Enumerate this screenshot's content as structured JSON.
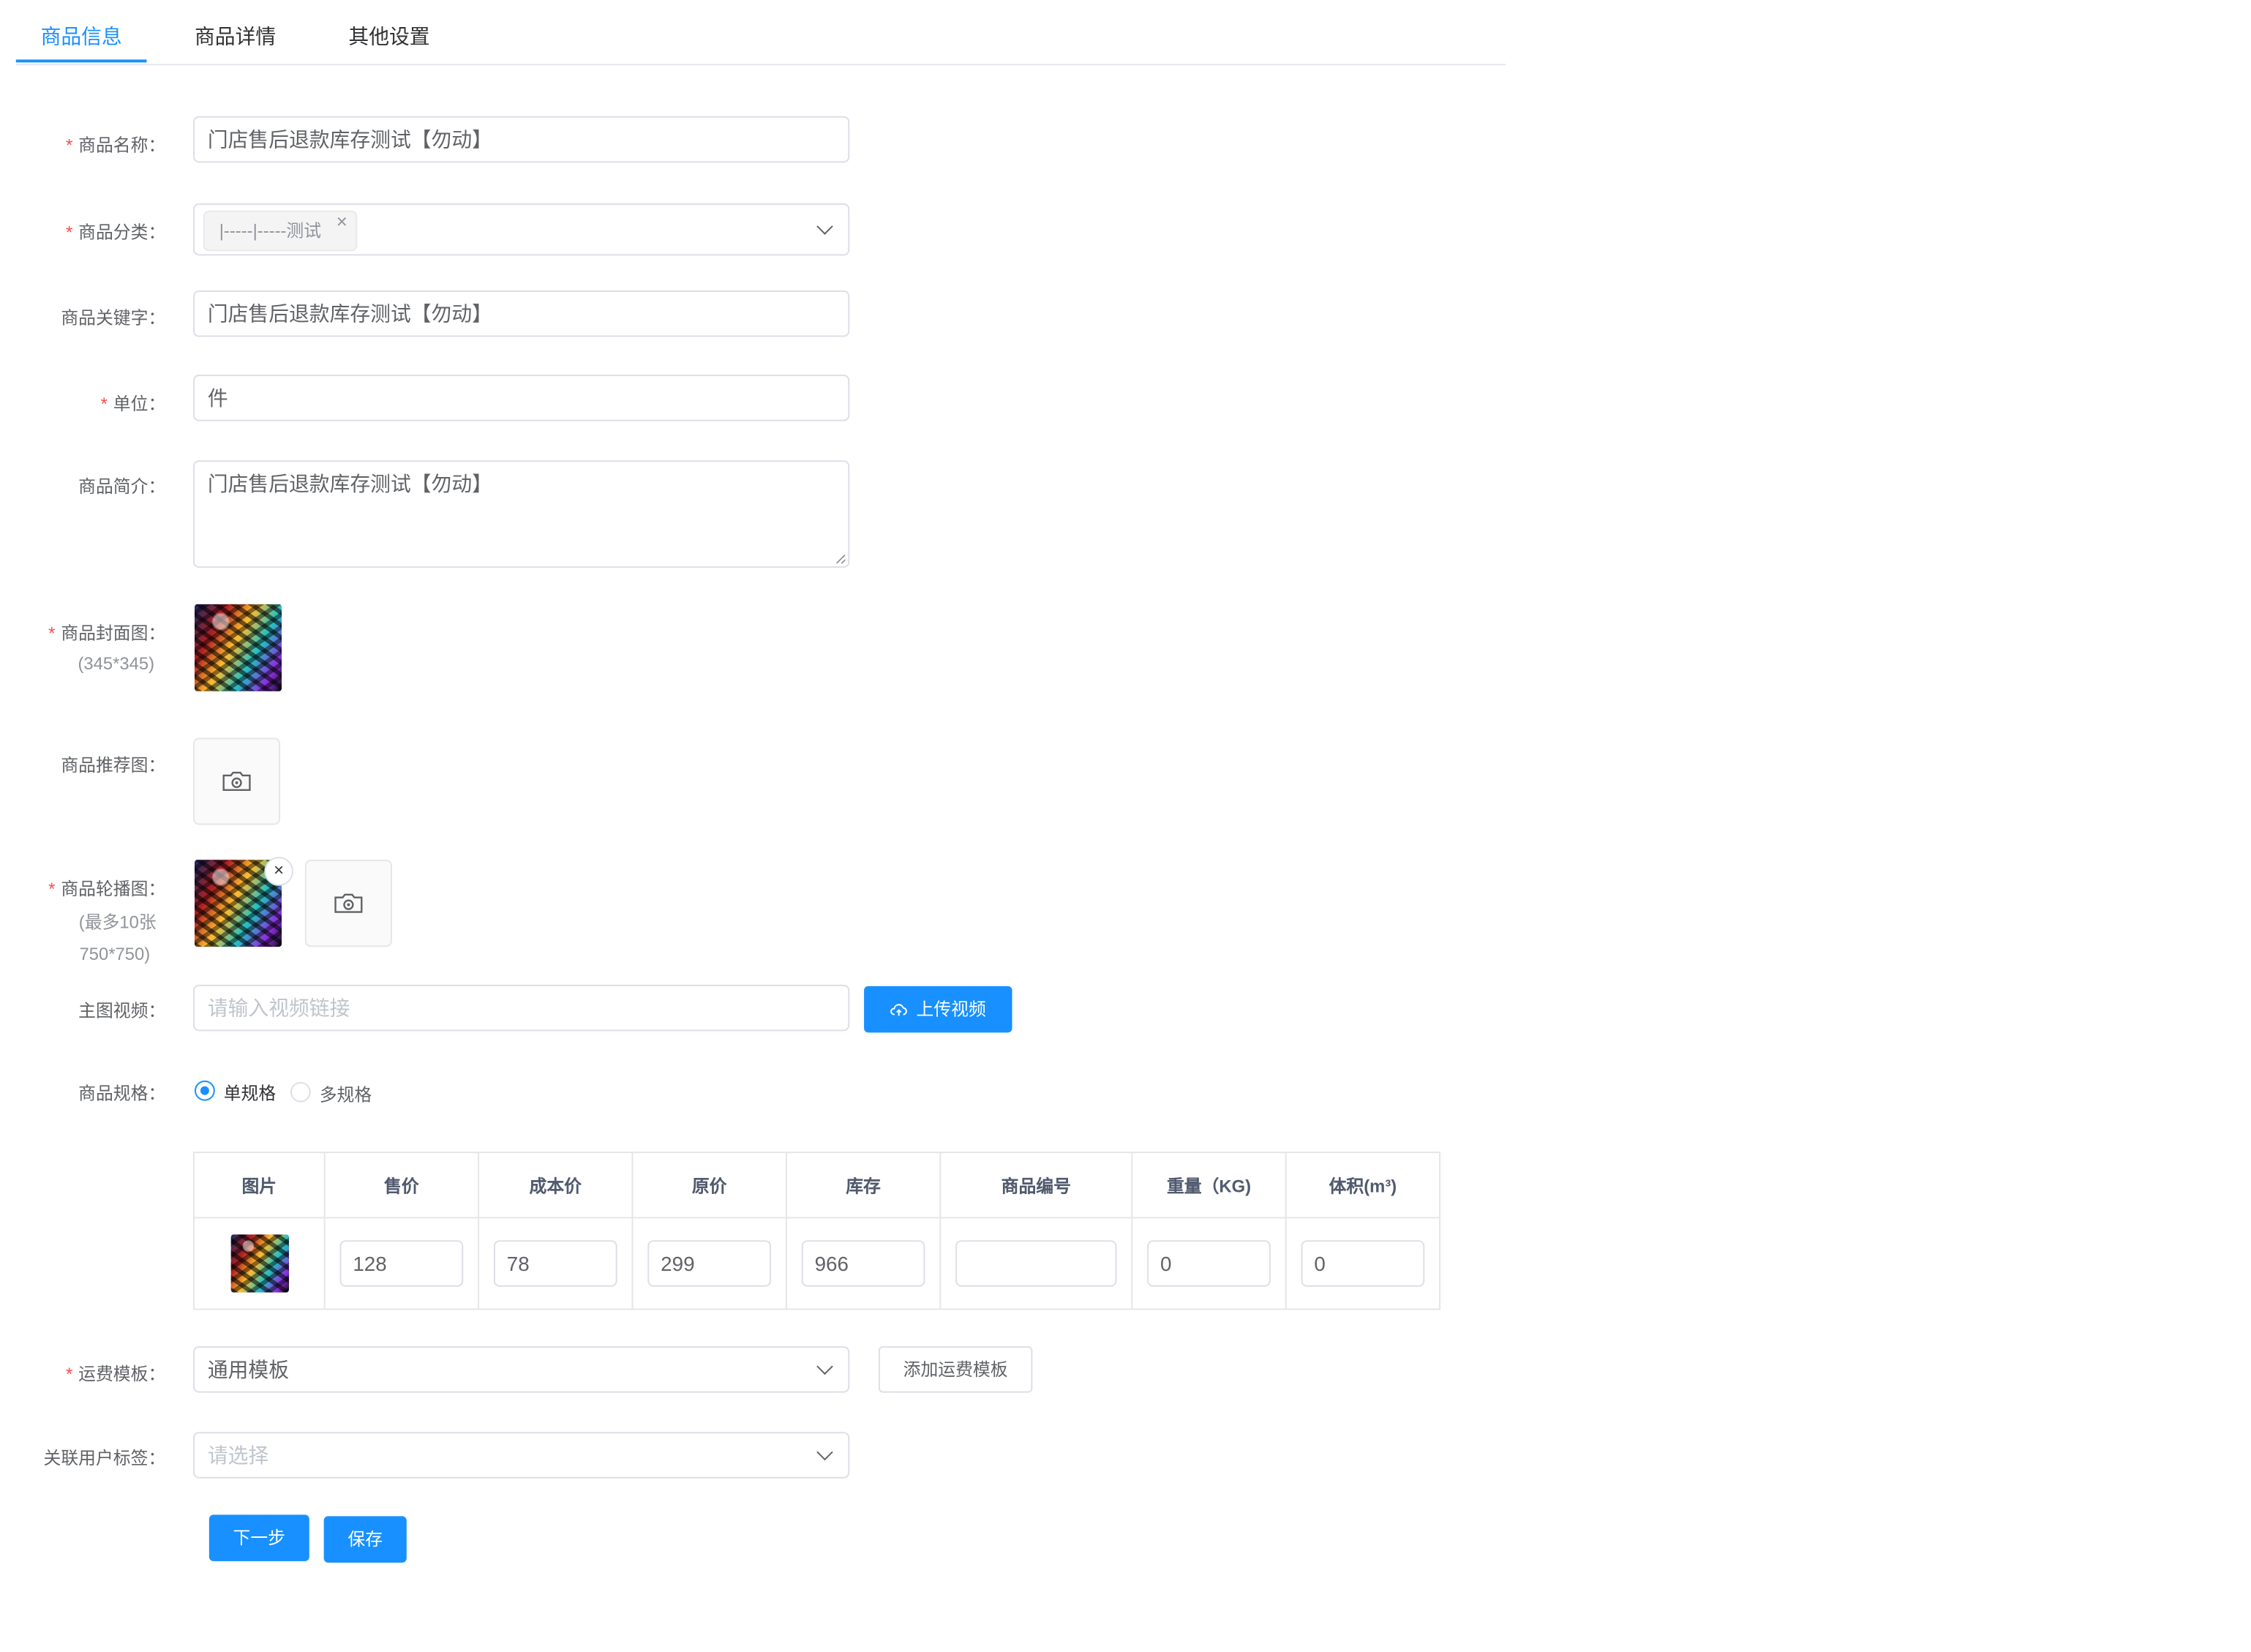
{
  "tabs": [
    {
      "label": "商品信息",
      "active": true
    },
    {
      "label": "商品详情",
      "active": false
    },
    {
      "label": "其他设置",
      "active": false
    }
  ],
  "form": {
    "name": {
      "label": "商品名称：",
      "required": true,
      "value": "门店售后退款库存测试【勿动】"
    },
    "category": {
      "label": "商品分类：",
      "required": true,
      "tag": "|-----|-----测试",
      "tag_close": "×"
    },
    "keywords": {
      "label": "商品关键字：",
      "value": "门店售后退款库存测试【勿动】"
    },
    "unit": {
      "label": "单位：",
      "required": true,
      "value": "件"
    },
    "summary": {
      "label": "商品简介：",
      "value": "门店售后退款库存测试【勿动】"
    },
    "cover": {
      "label": "商品封面图：",
      "required": true,
      "hint": "(345*345)"
    },
    "recommend": {
      "label": "商品推荐图："
    },
    "carousel": {
      "label": "商品轮播图：",
      "required": true,
      "hint_line1": "(最多10张",
      "hint_line2": "750*750)",
      "remove": "×"
    },
    "video": {
      "label": "主图视频：",
      "placeholder": "请输入视频链接",
      "upload_label": "上传视频"
    },
    "spec": {
      "label": "商品规格：",
      "options": [
        {
          "label": "单规格",
          "checked": true
        },
        {
          "label": "多规格",
          "checked": false
        }
      ]
    },
    "shipping": {
      "label": "运费模板：",
      "required": true,
      "value": "通用模板",
      "add_label": "添加运费模板"
    },
    "user_tag": {
      "label": "关联用户标签：",
      "placeholder": "请选择"
    }
  },
  "spec_table": {
    "headers": [
      "图片",
      "售价",
      "成本价",
      "原价",
      "库存",
      "商品编号",
      "重量（KG)",
      "体积(m³)"
    ],
    "row": {
      "price": "128",
      "cost": "78",
      "original": "299",
      "stock": "966",
      "code": "",
      "weight": "0",
      "volume": "0"
    }
  },
  "actions": {
    "next": "下一步",
    "save": "保存"
  },
  "colors": {
    "primary": "#1890ff",
    "required": "#ff4949",
    "border": "#dcdfe6"
  }
}
